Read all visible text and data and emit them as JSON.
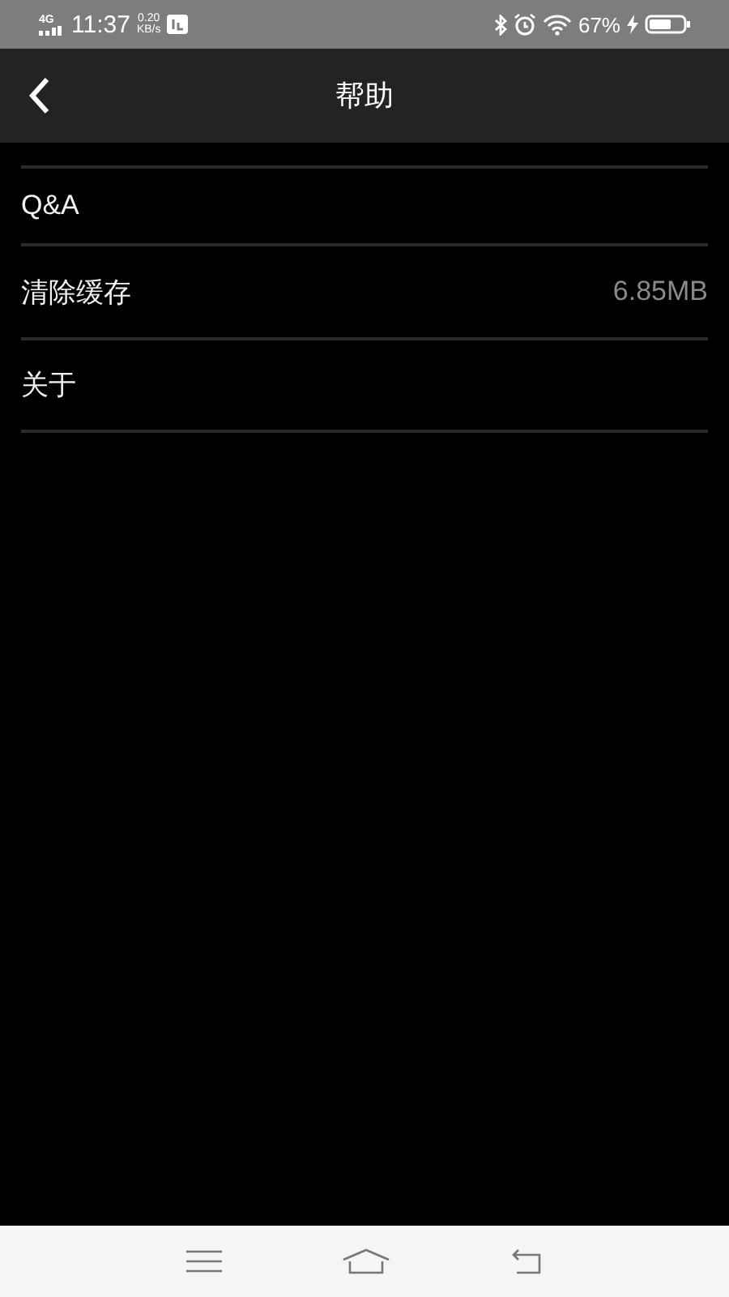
{
  "status_bar": {
    "network": "4G",
    "time": "11:37",
    "speed_value": "0.20",
    "speed_unit": "KB/s",
    "battery": "67%"
  },
  "header": {
    "title": "帮助"
  },
  "items": [
    {
      "label": "Q&A"
    },
    {
      "label": "清除缓存",
      "value": "6.85MB"
    },
    {
      "label": "关于"
    }
  ]
}
